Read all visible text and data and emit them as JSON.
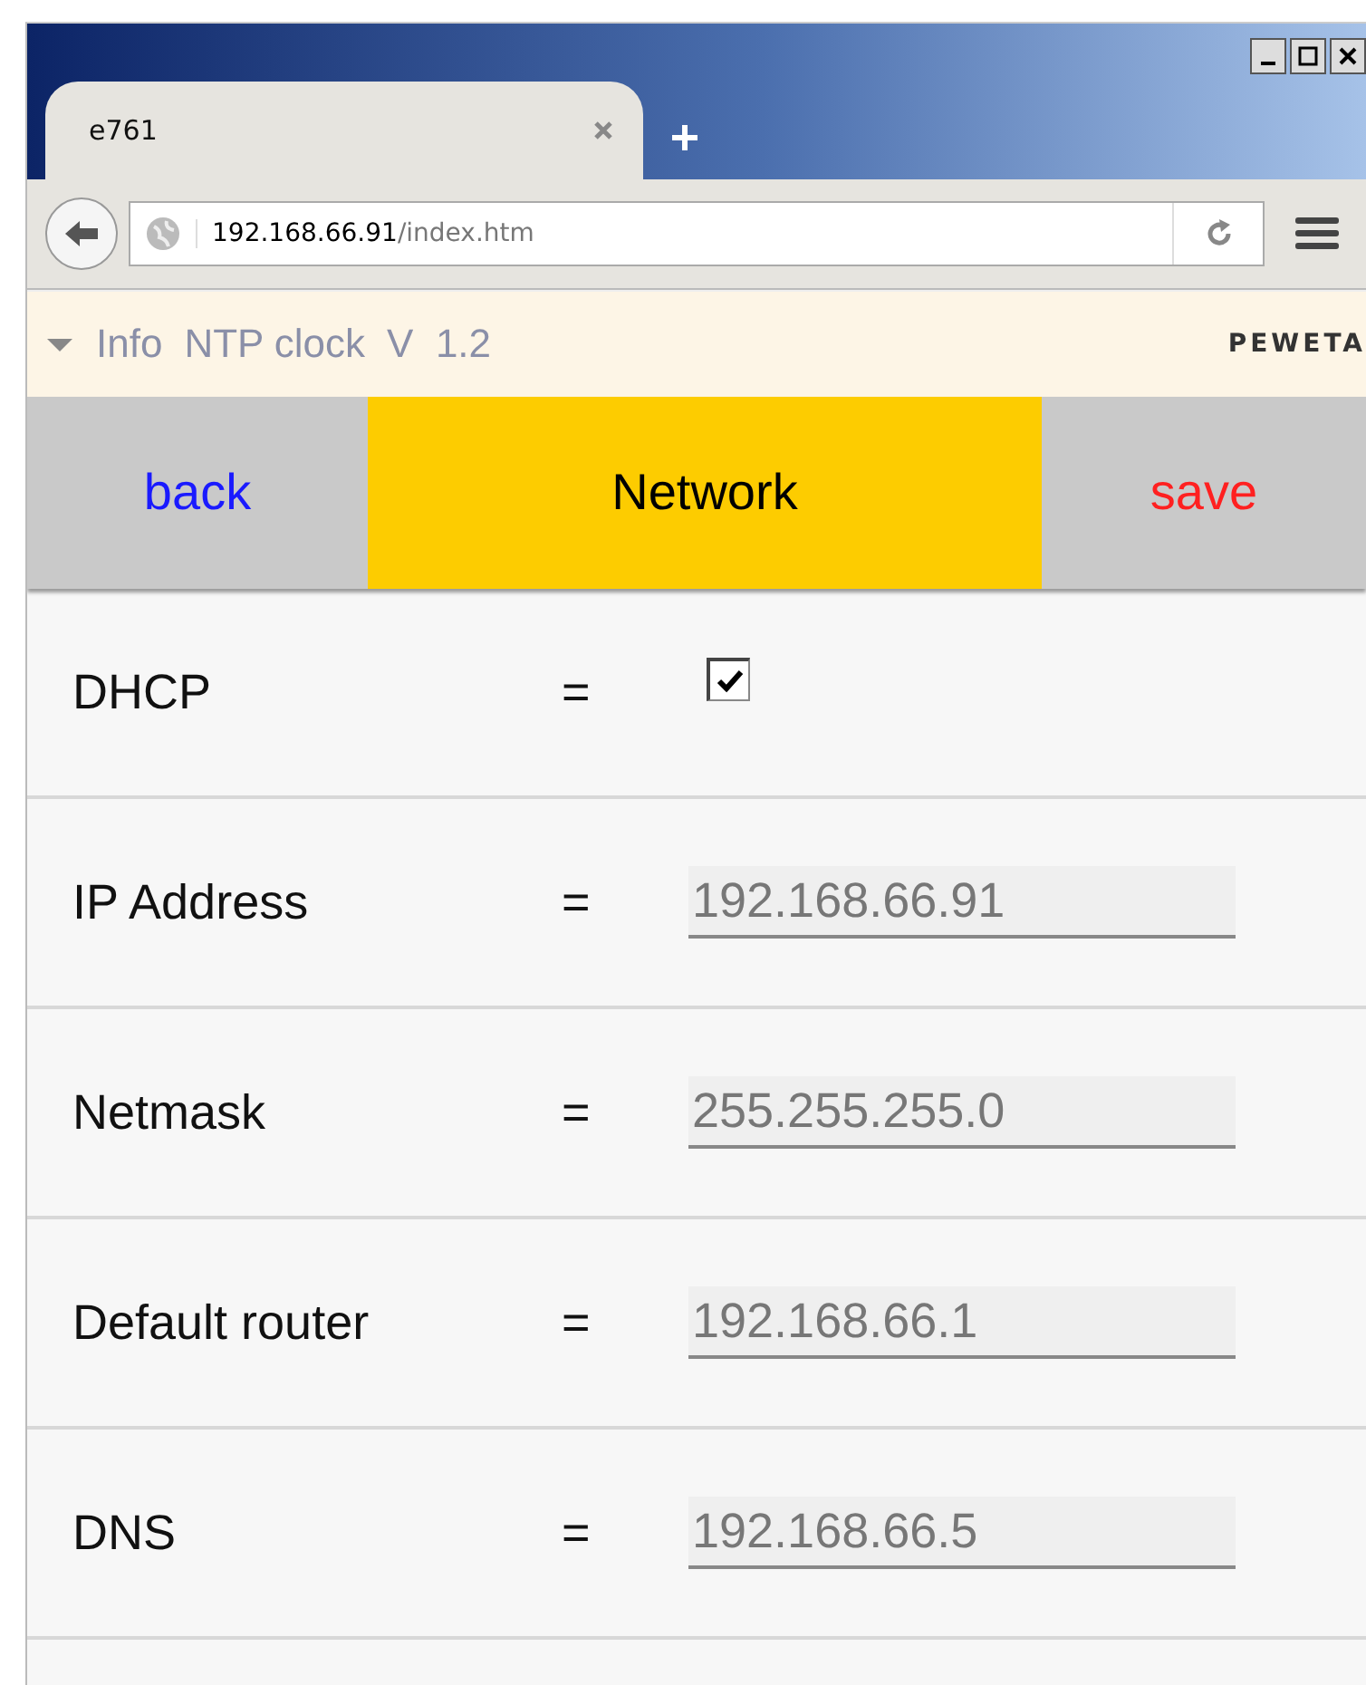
{
  "browser": {
    "tab": {
      "title": "e761",
      "selected": true
    },
    "url": {
      "host": "192.168.66.91",
      "path": "/index.htm"
    }
  },
  "info_bar": {
    "items": [
      "Info",
      "NTP clock",
      "V  1.2"
    ],
    "logo": "PEWETA"
  },
  "nav": [
    {
      "label": "back",
      "kind": "link",
      "color": "#1a1aff"
    },
    {
      "label": "Network",
      "kind": "title",
      "color": "#000000"
    },
    {
      "label": "save",
      "kind": "link",
      "color": "#ff2020"
    }
  ],
  "rows": [
    {
      "label": "DHCP",
      "sign": "=",
      "kind": "checkbox",
      "checked": true
    },
    {
      "label": "IP Address",
      "sign": "=",
      "kind": "text",
      "value": "192.168.66.91"
    },
    {
      "label": "Netmask",
      "sign": "=",
      "kind": "text",
      "value": "255.255.255.0"
    },
    {
      "label": "Default router",
      "sign": "=",
      "kind": "text",
      "value": "192.168.66.1"
    },
    {
      "label": "DNS",
      "sign": "=",
      "kind": "text",
      "value": "192.168.66.5"
    }
  ]
}
